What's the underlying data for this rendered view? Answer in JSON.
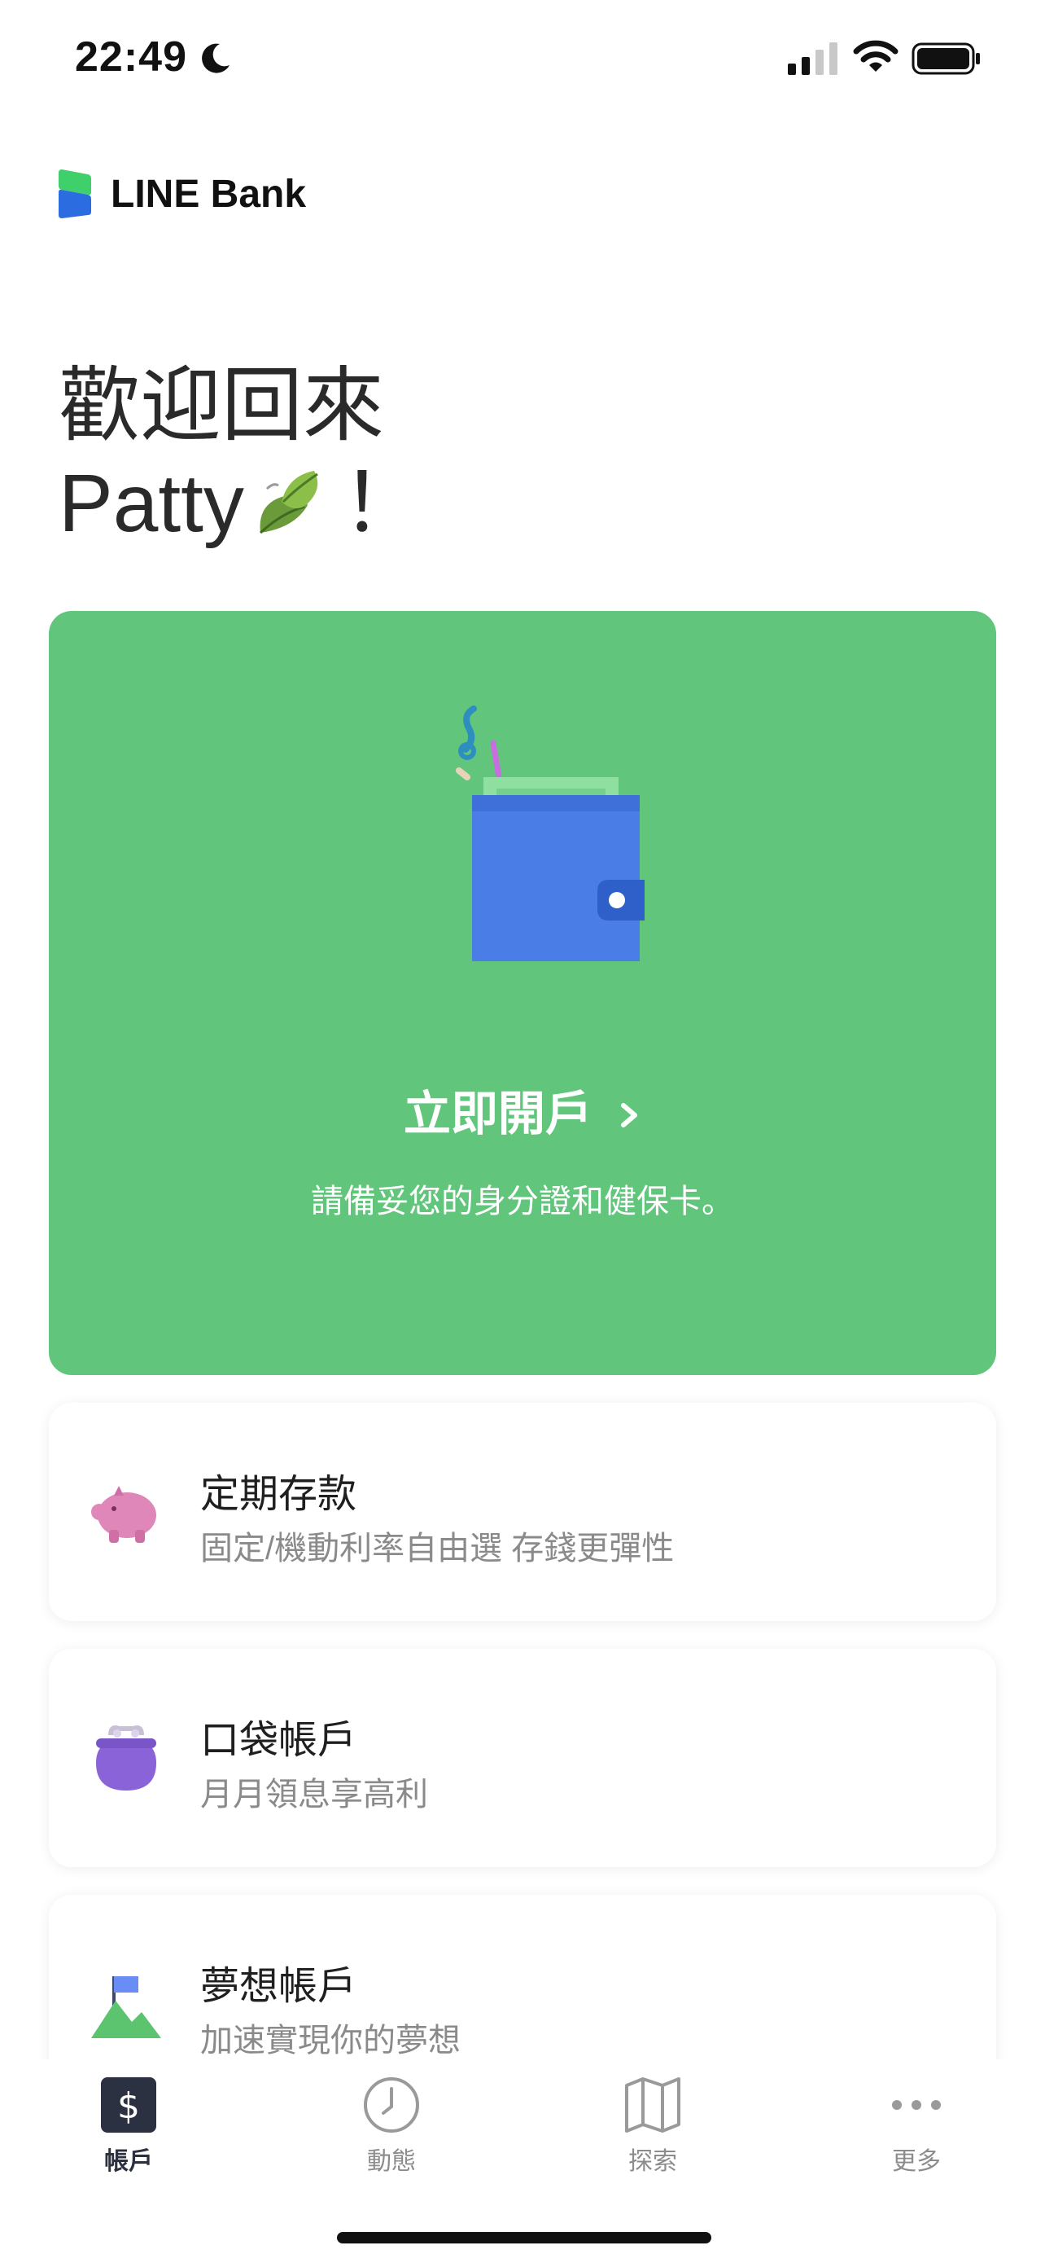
{
  "status_bar": {
    "time": "22:49"
  },
  "brand": {
    "name": "LINE Bank",
    "colors": {
      "green": "#3fcf6b",
      "blue": "#2b6de0"
    }
  },
  "greeting": {
    "line1": "歡迎回來",
    "name": "Patty",
    "suffix": "！"
  },
  "open_account_card": {
    "title": "立即開戶",
    "subtitle": "請備妥您的身分證和健保卡。",
    "background": "#61c67c"
  },
  "products": [
    {
      "title": "定期存款",
      "subtitle": "固定/機動利率自由選 存錢更彈性",
      "icon": "piggy-bank-icon"
    },
    {
      "title": "口袋帳戶",
      "subtitle": "月月領息享高利",
      "icon": "coin-purse-icon"
    },
    {
      "title": "夢想帳戶",
      "subtitle": "加速實現你的夢想",
      "icon": "mountain-flag-icon"
    }
  ],
  "tabs": [
    {
      "label": "帳戶",
      "icon": "dollar-icon",
      "active": true
    },
    {
      "label": "動態",
      "icon": "clock-icon",
      "active": false
    },
    {
      "label": "探索",
      "icon": "map-icon",
      "active": false
    },
    {
      "label": "更多",
      "icon": "more-dots-icon",
      "active": false
    }
  ]
}
